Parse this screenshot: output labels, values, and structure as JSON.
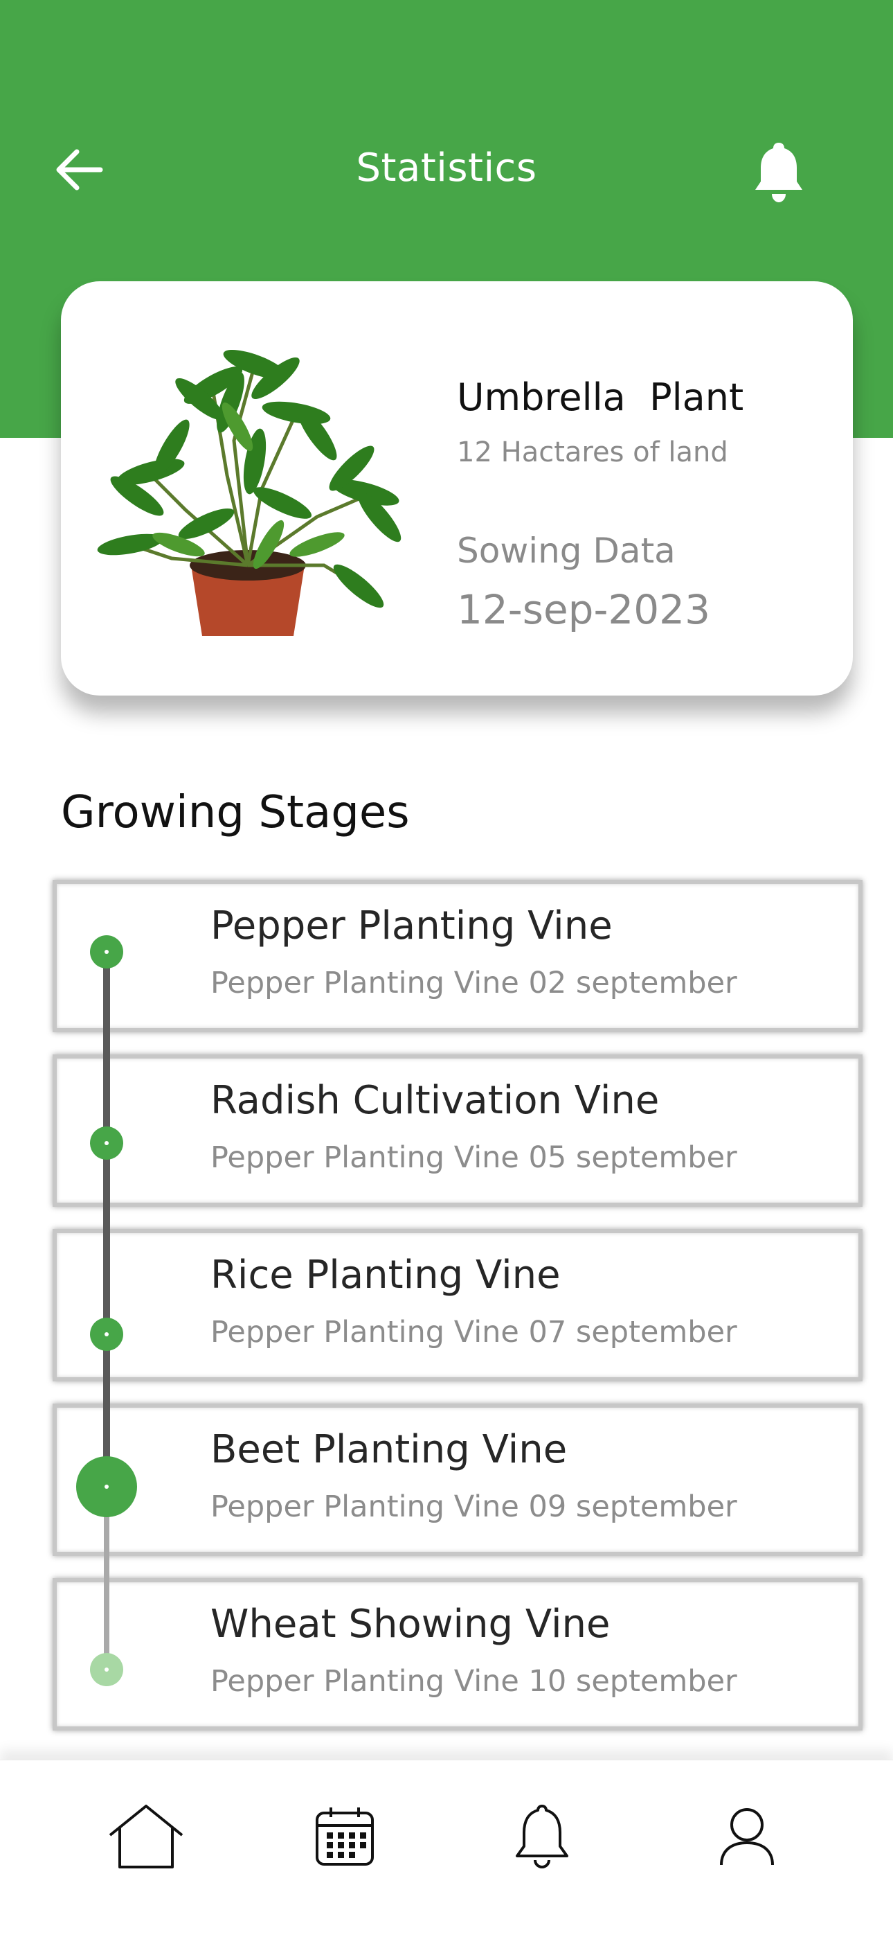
{
  "header": {
    "title": "Statistics",
    "back_icon": "arrow-left-icon",
    "notification_icon": "bell-icon",
    "background_color": "#47a648"
  },
  "plant": {
    "image_icon": "umbrella-plant-image",
    "name": "Umbrella  Plant",
    "land": "12 Hactares of land",
    "sowing_label": "Sowing Data",
    "sowing_date": "12-sep-2023"
  },
  "growing_stages": {
    "title": "Growing Stages",
    "accent_color": "#47a648",
    "items": [
      {
        "title": "Pepper Planting Vine",
        "subtitle": "Pepper Planting Vine 02 september"
      },
      {
        "title": "Radish Cultivation Vine",
        "subtitle": "Pepper Planting Vine 05 september"
      },
      {
        "title": "Rice Planting Vine",
        "subtitle": "Pepper Planting Vine 07 september"
      },
      {
        "title": "Beet Planting Vine",
        "subtitle": "Pepper Planting Vine 09 september"
      },
      {
        "title": "Wheat Showing Vine",
        "subtitle": "Pepper Planting Vine 10 september"
      }
    ]
  },
  "bottom_nav": {
    "items": [
      {
        "icon": "home-icon"
      },
      {
        "icon": "calendar-icon"
      },
      {
        "icon": "bell-icon"
      },
      {
        "icon": "user-icon"
      }
    ]
  }
}
